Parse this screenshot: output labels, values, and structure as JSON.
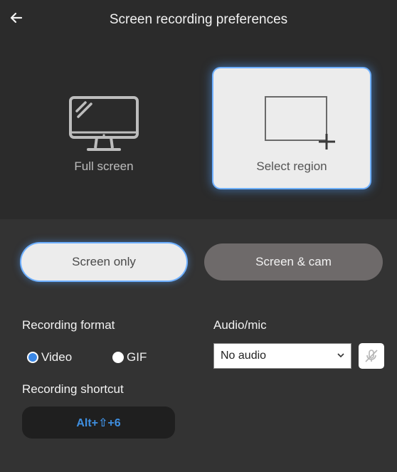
{
  "header": {
    "title": "Screen recording preferences",
    "back_icon": "arrow-left-icon"
  },
  "modes": {
    "full_screen": {
      "label": "Full screen",
      "icon": "monitor-icon",
      "selected": false
    },
    "select_region": {
      "label": "Select region",
      "icon": "region-plus-icon",
      "selected": true
    }
  },
  "capture": {
    "screen_only": {
      "label": "Screen only",
      "selected": true
    },
    "screen_cam": {
      "label": "Screen & cam",
      "selected": false
    }
  },
  "format": {
    "label": "Recording format",
    "options": [
      {
        "label": "Video",
        "selected": true
      },
      {
        "label": "GIF",
        "selected": false
      }
    ]
  },
  "shortcut": {
    "label": "Recording shortcut",
    "keys": "Alt+⇧+6"
  },
  "audio": {
    "label": "Audio/mic",
    "selected": "No audio",
    "mic_icon": "mic-off-icon"
  },
  "colors": {
    "accent": "#3a87e6",
    "glow": "#6fb0ff",
    "panel": "#2b2b2b",
    "background": "#333333"
  }
}
